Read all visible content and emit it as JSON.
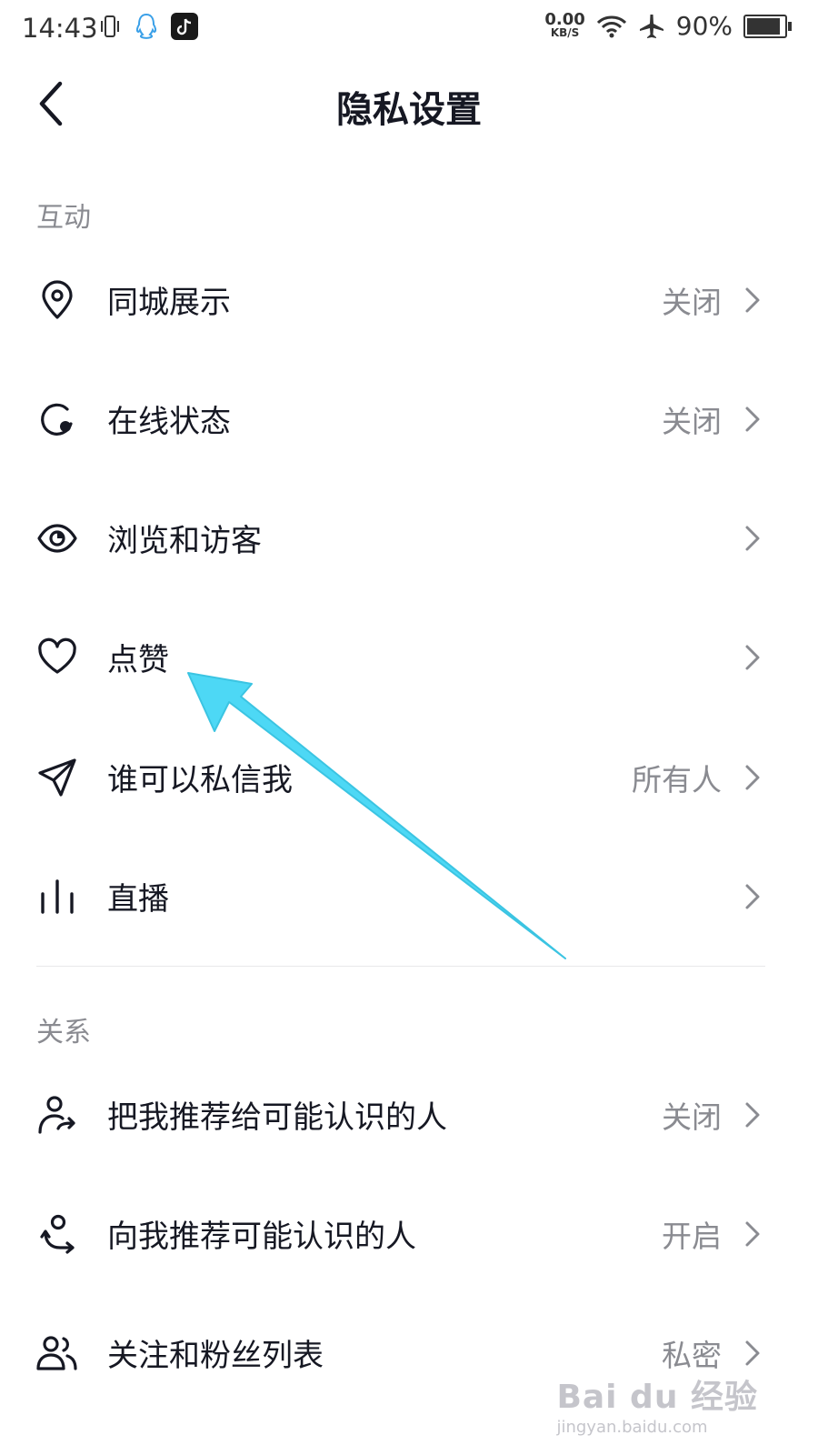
{
  "status_bar": {
    "time": "14:43",
    "net_speed_value": "0.00",
    "net_speed_unit": "KB/S",
    "battery": "90%"
  },
  "header": {
    "title": "隐私设置"
  },
  "sections": {
    "interaction": {
      "title": "互动"
    },
    "relations": {
      "title": "关系"
    }
  },
  "rows": {
    "local_display": {
      "label": "同城展示",
      "value": "关闭"
    },
    "online_status": {
      "label": "在线状态",
      "value": "关闭"
    },
    "browse_visitors": {
      "label": "浏览和访客",
      "value": ""
    },
    "likes": {
      "label": "点赞",
      "value": ""
    },
    "who_can_message": {
      "label": "谁可以私信我",
      "value": "所有人"
    },
    "live": {
      "label": "直播",
      "value": ""
    },
    "recommend_me": {
      "label": "把我推荐给可能认识的人",
      "value": "关闭"
    },
    "recommend_to_me": {
      "label": "向我推荐可能认识的人",
      "value": "开启"
    },
    "follow_list": {
      "label": "关注和粉丝列表",
      "value": "私密"
    }
  },
  "watermark": {
    "main": "Bai du 经验",
    "sub": "jingyan.baidu.com"
  },
  "colors": {
    "annotation_arrow": "#4dd8f5",
    "text_primary": "#161823",
    "text_secondary": "#8a8b91"
  }
}
